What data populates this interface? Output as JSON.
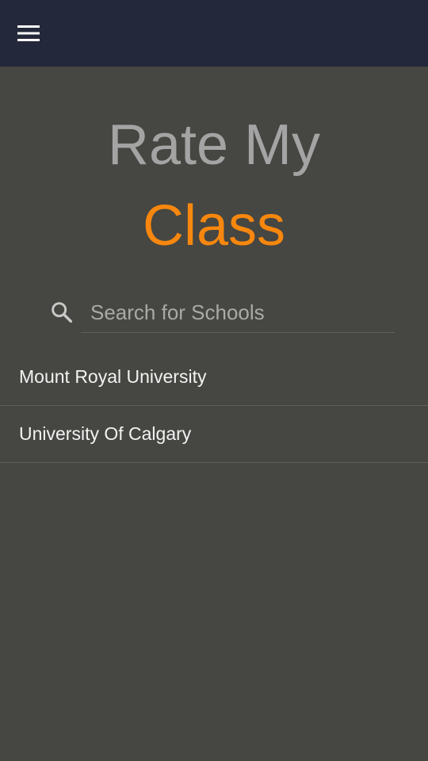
{
  "topbar": {
    "menu_icon": "hamburger-menu-icon",
    "background": "#23283a"
  },
  "hero": {
    "line1": "Rate My",
    "line2": "Class",
    "line1_color": "#a4a4a4",
    "line2_color": "#f7870e"
  },
  "search": {
    "icon": "search-icon",
    "placeholder": "Search for Schools",
    "value": ""
  },
  "schools": [
    {
      "name": "Mount Royal University"
    },
    {
      "name": "University Of Calgary"
    }
  ],
  "colors": {
    "background": "#464642",
    "accent": "#f7870e",
    "divider": "#5e5e5a"
  }
}
